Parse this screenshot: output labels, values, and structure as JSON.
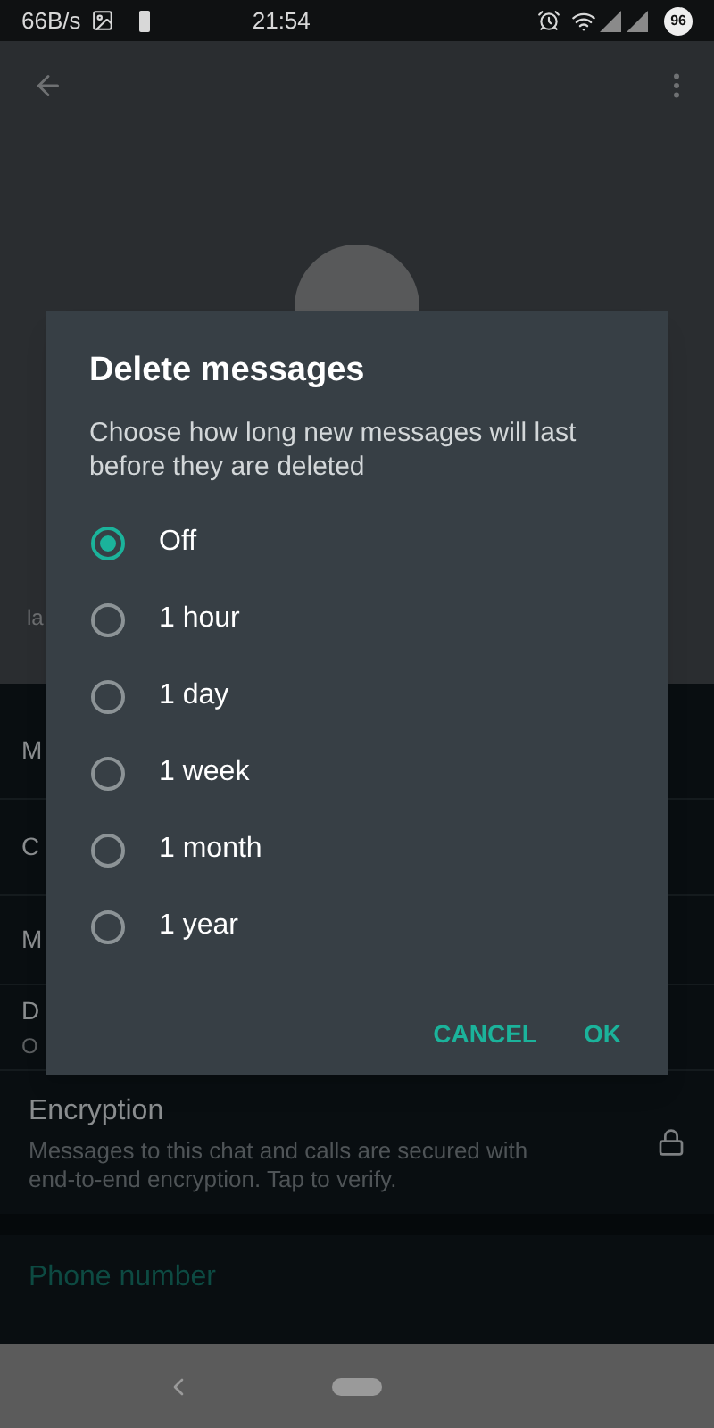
{
  "status_bar": {
    "speed": "66B/s",
    "time": "21:54",
    "battery": "96"
  },
  "profile": {
    "subtitle": "la"
  },
  "rows": [
    {
      "title": "M"
    },
    {
      "title": "C"
    },
    {
      "title": "M"
    },
    {
      "title": "D",
      "value": "O"
    }
  ],
  "encryption": {
    "title": "Encryption",
    "description": "Messages to this chat and calls are secured with end-to-end encryption. Tap to verify."
  },
  "phone_section": {
    "title": "Phone number"
  },
  "dialog": {
    "title": "Delete messages",
    "description": "Choose how long new messages will last before they are deleted",
    "options": [
      {
        "label": "Off",
        "selected": true
      },
      {
        "label": "1 hour",
        "selected": false
      },
      {
        "label": "1 day",
        "selected": false
      },
      {
        "label": "1 week",
        "selected": false
      },
      {
        "label": "1 month",
        "selected": false
      },
      {
        "label": "1 year",
        "selected": false
      }
    ],
    "buttons": [
      "CANCEL",
      "OK"
    ]
  }
}
